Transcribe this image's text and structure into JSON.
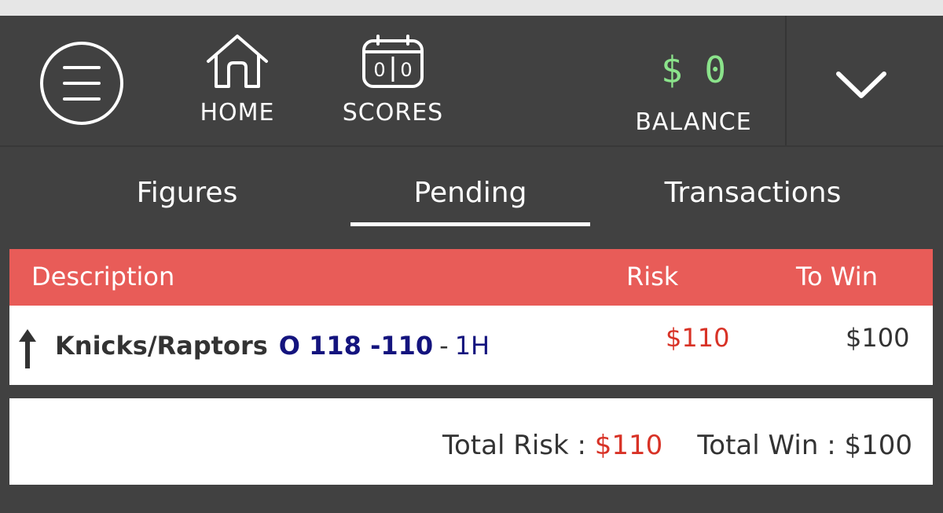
{
  "colors": {
    "background": "#414141",
    "accent_header": "#e85c58",
    "balance_green": "#8be38b",
    "risk_red": "#d83226",
    "line_blue": "#14147e"
  },
  "header": {
    "menu_icon": "hamburger-icon",
    "home": {
      "label": "HOME",
      "icon": "home-icon"
    },
    "scores": {
      "label": "SCORES",
      "icon": "scoreboard-icon",
      "board_digits": [
        "0",
        "0"
      ]
    },
    "balance": {
      "amount": "$ 0",
      "label": "BALANCE"
    },
    "dropdown_icon": "chevron-down-icon"
  },
  "tabs": [
    {
      "label": "Figures",
      "active": false
    },
    {
      "label": "Pending",
      "active": true
    },
    {
      "label": "Transactions",
      "active": false
    }
  ],
  "table": {
    "columns": {
      "description": "Description",
      "risk": "Risk",
      "to_win": "To Win"
    },
    "rows": [
      {
        "icon": "arrow-up-icon",
        "teams": "Knicks/Raptors",
        "line": "O 118 -110",
        "separator": "-",
        "period": "1H",
        "risk": "$110",
        "to_win": "$100"
      }
    ]
  },
  "totals": {
    "risk_label": "Total Risk :",
    "risk_value": "$110",
    "win_label": "Total Win :",
    "win_value": "$100"
  }
}
